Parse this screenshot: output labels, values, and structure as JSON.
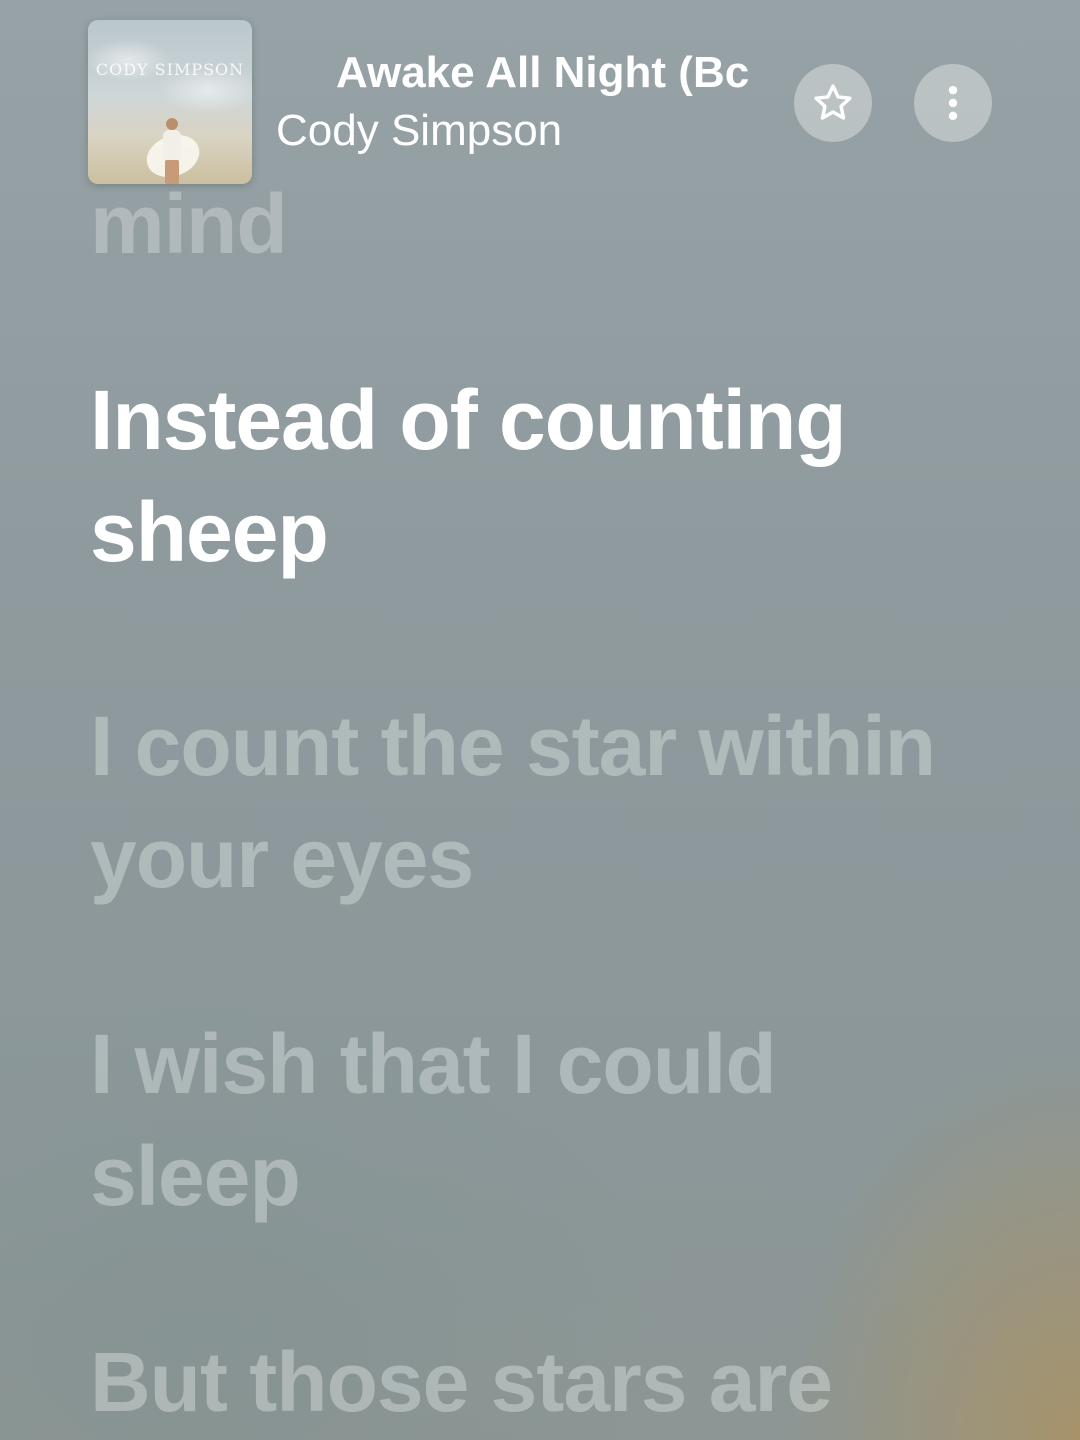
{
  "now_playing": {
    "title": "Awake All Night (Bc",
    "artist": "Cody Simpson",
    "album_art_text": "CODY SIMPSON"
  },
  "controls": {
    "favorite_icon": "star-icon",
    "more_icon": "more-vertical-icon"
  },
  "lyrics": {
    "previous": "mind",
    "active": "Instead of counting sheep",
    "upcoming": [
      "I count the star within your eyes",
      "I wish that I could sleep",
      "But those stars are"
    ]
  },
  "colors": {
    "background": "#8e9a9d",
    "active_lyric": "#ffffff",
    "inactive_lyric": "#c5cdce"
  }
}
